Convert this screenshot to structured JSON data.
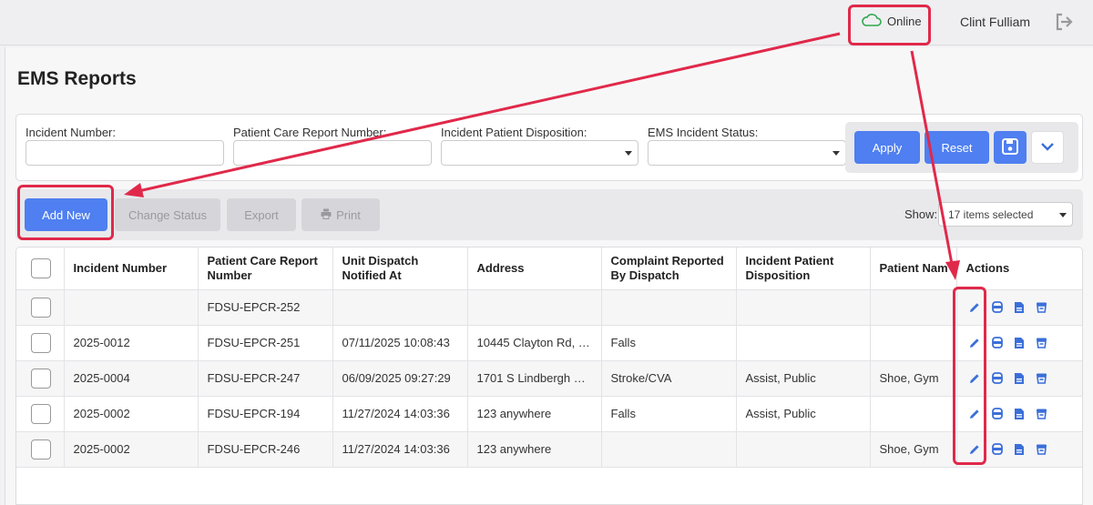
{
  "header": {
    "status": "Online",
    "user": "Clint Fulliam"
  },
  "page": {
    "title": "EMS Reports"
  },
  "filters": {
    "incident_number_label": "Incident Number:",
    "pcr_number_label": "Patient Care Report Number:",
    "disposition_label": "Incident Patient Disposition:",
    "status_label": "EMS Incident Status:",
    "apply": "Apply",
    "reset": "Reset"
  },
  "toolbar": {
    "add_new": "Add New",
    "change_status": "Change Status",
    "export": "Export",
    "print": "Print",
    "show_label": "Show:",
    "show_value": "17 items selected"
  },
  "table": {
    "columns": [
      "Incident Number",
      "Patient Care Report Number",
      "Unit Dispatch Notified At",
      "Address",
      "Complaint Reported By Dispatch",
      "Incident Patient Disposition",
      "Patient Nam",
      "Actions"
    ],
    "rows": [
      {
        "incident": "",
        "pcr": "FDSU-EPCR-252",
        "notified": "",
        "address": "",
        "complaint": "",
        "disposition": "",
        "patient": ""
      },
      {
        "incident": "2025-0012",
        "pcr": "FDSU-EPCR-251",
        "notified": "07/11/2025 10:08:43",
        "address": "10445 Clayton Rd, 6...",
        "complaint": "Falls",
        "disposition": "",
        "patient": ""
      },
      {
        "incident": "2025-0004",
        "pcr": "FDSU-EPCR-247",
        "notified": "06/09/2025 09:27:29",
        "address": "1701 S Lindbergh Bl...",
        "complaint": "Stroke/CVA",
        "disposition": "Assist, Public",
        "patient": "Shoe, Gym"
      },
      {
        "incident": "2025-0002",
        "pcr": "FDSU-EPCR-194",
        "notified": "11/27/2024 14:03:36",
        "address": "123 anywhere",
        "complaint": "Falls",
        "disposition": "Assist, Public",
        "patient": ""
      },
      {
        "incident": "2025-0002",
        "pcr": "FDSU-EPCR-246",
        "notified": "11/27/2024 14:03:36",
        "address": "123 anywhere",
        "complaint": "",
        "disposition": "",
        "patient": "Shoe, Gym"
      }
    ]
  },
  "colors": {
    "primary": "#4f7ff0",
    "highlight": "#e0294a",
    "online": "#2fa84f",
    "icon": "#3b6fd9"
  }
}
